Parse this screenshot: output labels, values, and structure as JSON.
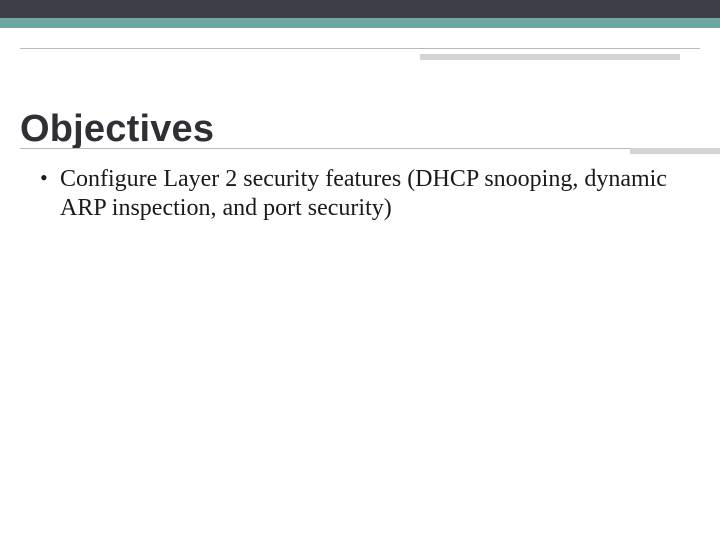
{
  "slide": {
    "title": "Objectives",
    "bullets": [
      "Configure Layer 2 security features (DHCP snooping, dynamic ARP inspection, and port security)"
    ]
  }
}
